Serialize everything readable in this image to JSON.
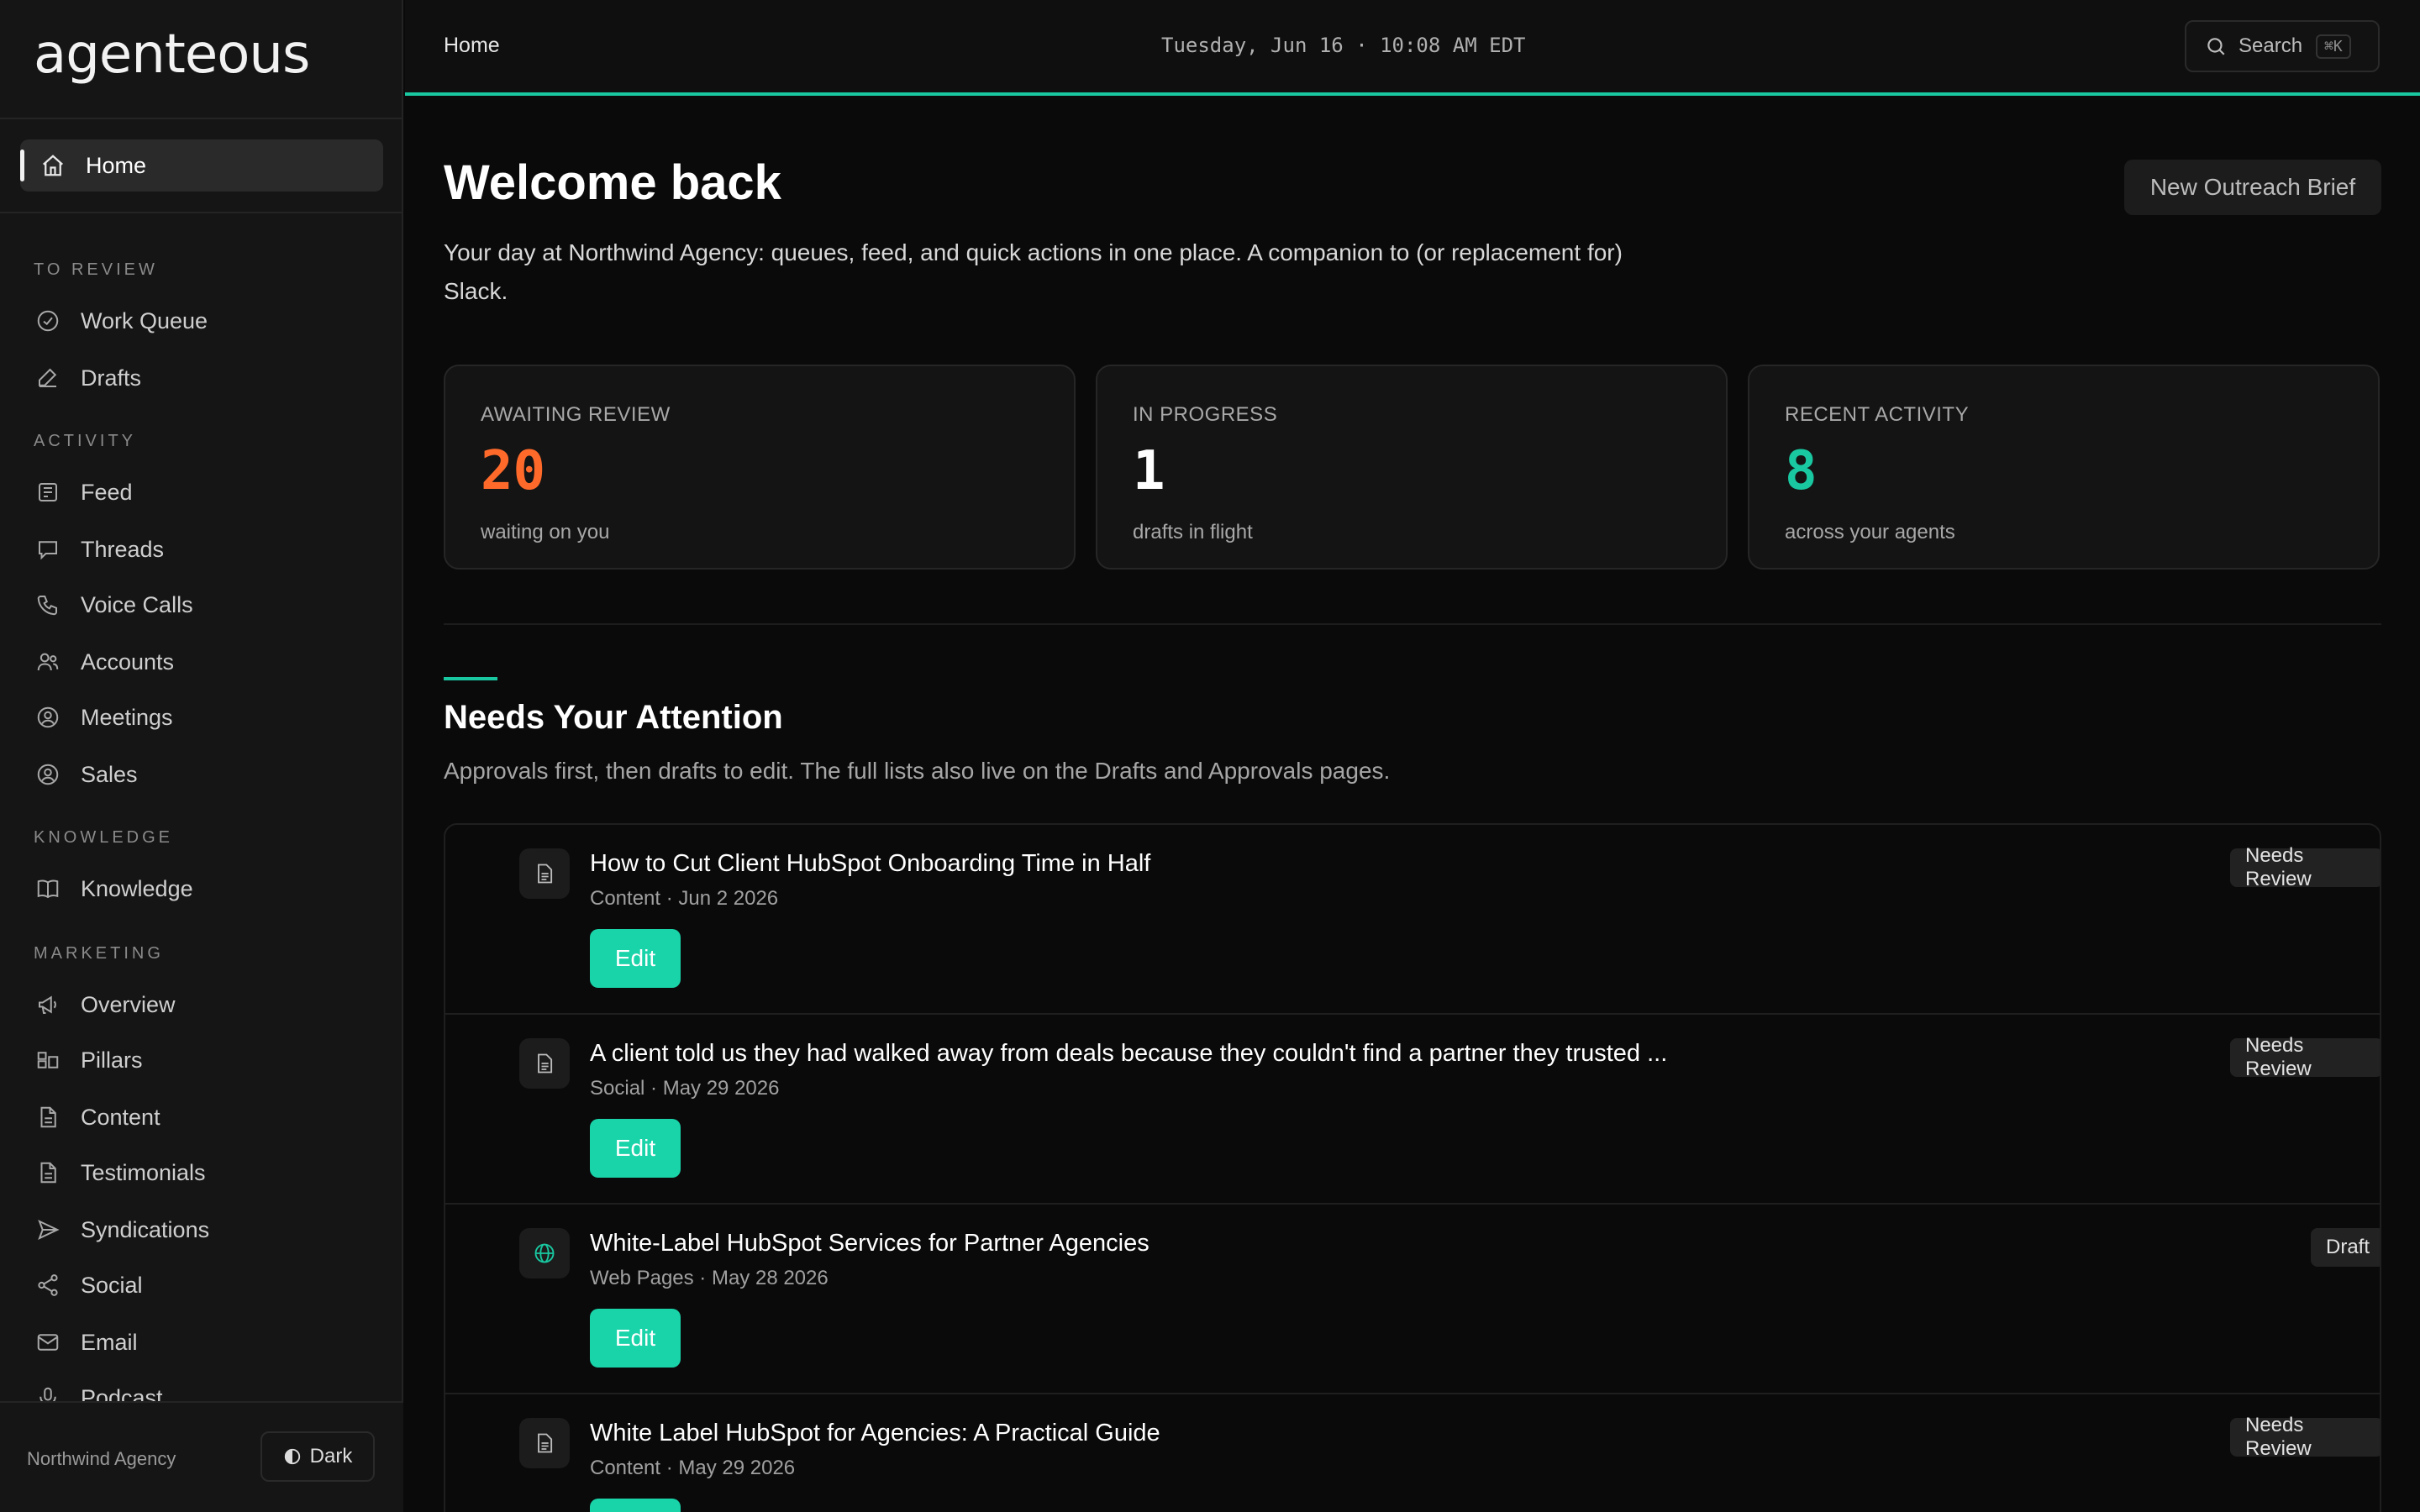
{
  "app": {
    "logo": "agenteous"
  },
  "sidebar": {
    "home": "Home",
    "sections": {
      "to_review": "TO REVIEW",
      "activity": "ACTIVITY",
      "knowledge": "KNOWLEDGE",
      "marketing": "MARKETING"
    },
    "items": {
      "work_queue": "Work Queue",
      "drafts": "Drafts",
      "feed": "Feed",
      "threads": "Threads",
      "voice_calls": "Voice Calls",
      "accounts": "Accounts",
      "meetings": "Meetings",
      "sales": "Sales",
      "knowledge": "Knowledge",
      "overview": "Overview",
      "pillars": "Pillars",
      "content": "Content",
      "testimonials": "Testimonials",
      "syndications": "Syndications",
      "social": "Social",
      "email": "Email",
      "podcast": "Podcast"
    },
    "footer": {
      "org": "Northwind Agency",
      "theme": "Dark"
    }
  },
  "header": {
    "breadcrumb": "Home",
    "datetime": "Tuesday, Jun 16 · 10:08 AM EDT",
    "search_label": "Search",
    "search_shortcut": "⌘K"
  },
  "main": {
    "title": "Welcome back",
    "new_brief_button": "New Outreach Brief",
    "subtitle": "Your day at Northwind Agency: queues, feed, and quick actions in one place. A companion to (or replacement for) Slack.",
    "stats": [
      {
        "label": "AWAITING REVIEW",
        "value": "20",
        "note": "waiting on you",
        "color": "#ff6a2b"
      },
      {
        "label": "IN PROGRESS",
        "value": "1",
        "note": "drafts in flight",
        "color": "#ffffff"
      },
      {
        "label": "RECENT ACTIVITY",
        "value": "8",
        "note": "across your agents",
        "color": "#19c8a1"
      }
    ],
    "attention": {
      "title": "Needs Your Attention",
      "subtitle": "Approvals first, then drafts to edit. The full lists also live on the Drafts and Approvals pages.",
      "edit_label": "Edit",
      "items": [
        {
          "title": "How to Cut Client HubSpot Onboarding Time in Half",
          "meta": "Content · Jun 2 2026",
          "status": "Needs Review",
          "icon": "document-icon"
        },
        {
          "title": "A client told us they had walked away from deals because they couldn't find a partner they trusted ...",
          "meta": "Social · May 29 2026",
          "status": "Needs Review",
          "icon": "document-icon"
        },
        {
          "title": "White-Label HubSpot Services for Partner Agencies",
          "meta": "Web Pages · May 28 2026",
          "status": "Draft",
          "icon": "globe-icon"
        },
        {
          "title": "White Label HubSpot for Agencies: A Practical Guide",
          "meta": "Content · May 29 2026",
          "status": "Needs Review",
          "icon": "document-icon"
        }
      ]
    }
  }
}
